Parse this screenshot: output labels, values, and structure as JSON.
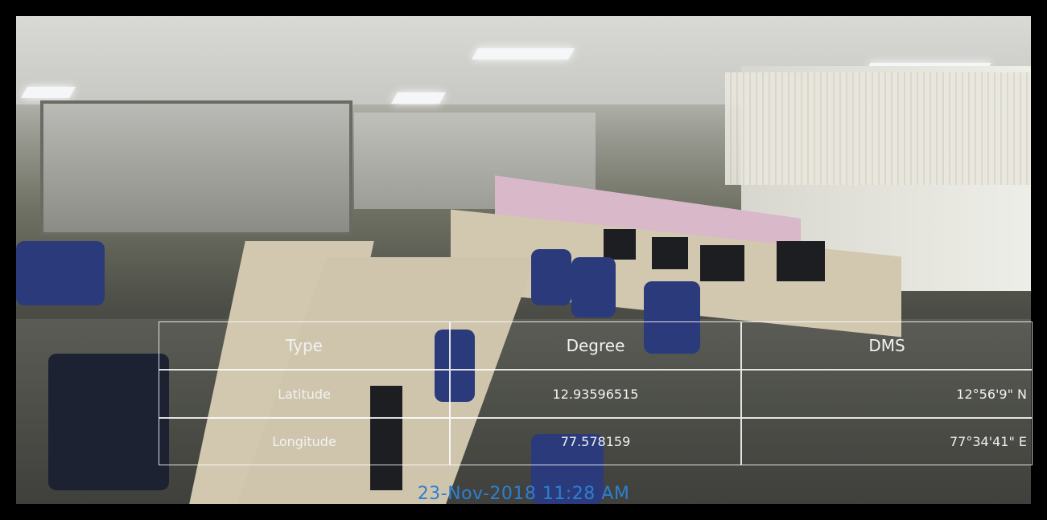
{
  "table": {
    "headers": [
      "Type",
      "Degree",
      "DMS"
    ],
    "rows": [
      {
        "type": "Latitude",
        "degree": "12.93596515",
        "dms": "12°56'9\" N"
      },
      {
        "type": "Longitude",
        "degree": "77.578159",
        "dms": "77°34'41\" E"
      }
    ]
  },
  "timestamp": "23-Nov-2018 11:28 AM",
  "colors": {
    "frame": "#000000",
    "timestamp_text": "#2d7fd3",
    "table_border": "#ffffff",
    "table_text": "#f2f2f2"
  }
}
